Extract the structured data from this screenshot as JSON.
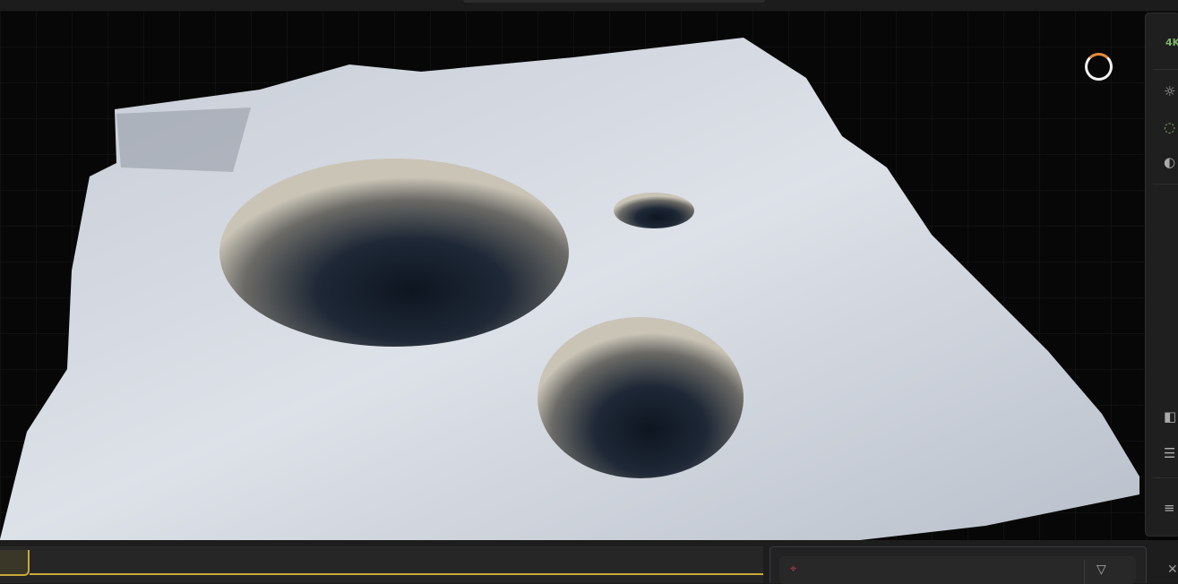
{
  "viewport": {
    "resolution_label": "4K"
  },
  "right_toolbar": {
    "icons": [
      "sun-icon",
      "refresh-icon",
      "globe-icon",
      "split-view-icon",
      "ruler-icon",
      "menu-icon"
    ]
  },
  "bottom": {
    "node_graph_tab": "",
    "properties_icons": [
      "target-icon",
      "filter-icon",
      "close-icon"
    ]
  }
}
